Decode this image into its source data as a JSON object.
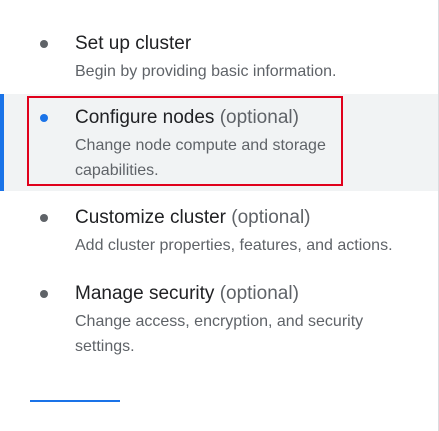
{
  "steps": [
    {
      "title": "Set up cluster",
      "optional": "",
      "description": "Begin by providing basic information.",
      "active": false
    },
    {
      "title": "Configure nodes",
      "optional": "(optional)",
      "description": "Change node compute and storage capabilities.",
      "active": true
    },
    {
      "title": "Customize cluster",
      "optional": "(optional)",
      "description": "Add cluster properties, features, and actions.",
      "active": false
    },
    {
      "title": "Manage security",
      "optional": "(optional)",
      "description": "Change access, encryption, and security settings.",
      "active": false
    }
  ],
  "colors": {
    "accent": "#1a73e8",
    "highlight": "#e0001b",
    "active_background": "#f1f3f4",
    "inactive_dot": "#5f6368"
  }
}
